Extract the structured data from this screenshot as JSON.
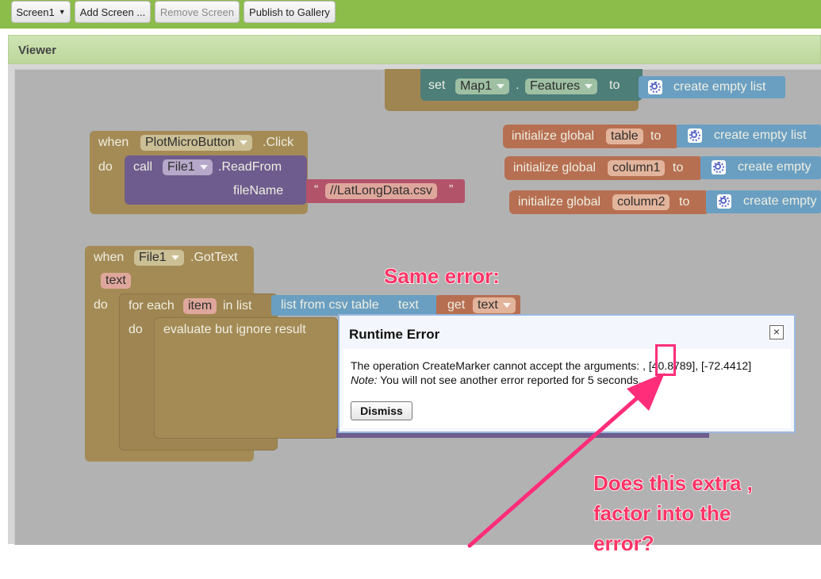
{
  "toolbar": {
    "screen_select": "Screen1",
    "add_screen": "Add Screen ...",
    "remove_screen": "Remove Screen",
    "publish": "Publish to Gallery"
  },
  "viewer": {
    "title": "Viewer"
  },
  "blocks": {
    "set_features": {
      "set": "set",
      "component": "Map1",
      "dot": ".",
      "property": "Features",
      "to": "to",
      "value": "create empty list"
    },
    "click_event": {
      "when": "when",
      "component": "PlotMicroButton",
      "event": ".Click",
      "do": "do",
      "call": "call",
      "file": "File1",
      "method": ".ReadFrom",
      "param": "fileName",
      "open_quote": "“",
      "value": "//LatLongData.csv",
      "close_quote": "”"
    },
    "globals": [
      {
        "label": "initialize global",
        "name": "table",
        "to": "to",
        "value": "create empty list"
      },
      {
        "label": "initialize global",
        "name": "column1",
        "to": "to",
        "value": "create empty"
      },
      {
        "label": "initialize global",
        "name": "column2",
        "to": "to",
        "value": "create empty"
      }
    ],
    "gottext_event": {
      "when": "when",
      "component": "File1",
      "event": ".GotText",
      "param": "text",
      "do": "do",
      "for_each": "for each",
      "item": "item",
      "in_list": "in list",
      "list_from": "list from csv table",
      "text_label": "text",
      "get": "get",
      "get_var": "text",
      "do2": "do",
      "evaluate": "evaluate but ignore result"
    }
  },
  "dialog": {
    "title": "Runtime Error",
    "message": "The operation CreateMarker cannot accept the arguments: , [40.8789], [-72.4412]",
    "note_label": "Note:",
    "note_text": " You will not see another error reported for 5 seconds.",
    "dismiss": "Dismiss",
    "close": "×"
  },
  "annotations": {
    "same_error": "Same error:",
    "question_line1": "Does this extra ,",
    "question_line2": "factor into the",
    "question_line3": "error?"
  },
  "colors": {
    "accent": "#ff3366",
    "toolbar": "#8cbc4a"
  }
}
